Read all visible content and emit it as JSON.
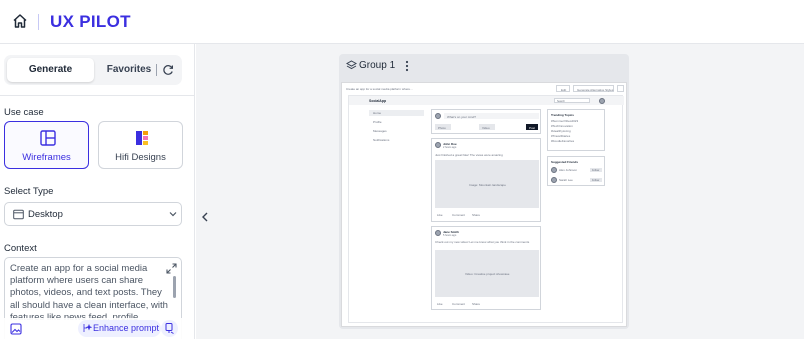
{
  "app": {
    "brand": "UX PILOT"
  },
  "colors": {
    "accent": "#3b2fe0",
    "canvas_bg": "#f3f4f6",
    "accent_soft": "#eef0ff"
  },
  "icons": {
    "home": "home-icon",
    "refresh": "refresh-icon",
    "wireframes": "layout-icon",
    "hifi": "palette-icon",
    "desktop": "monitor-icon",
    "chevron": "chevron-down-icon",
    "expand": "expand-icon",
    "image": "image-icon",
    "enhance": "sparkle-icon",
    "voice": "voice-icon",
    "collapse": "chevron-left-icon",
    "group": "layers-icon",
    "menu": "kebab-icon"
  },
  "tabs": {
    "generate": "Generate",
    "favorites": "Favorites"
  },
  "use_case": {
    "label": "Use case",
    "options": [
      {
        "label": "Wireframes",
        "selected": true
      },
      {
        "label": "Hifi Designs",
        "selected": false
      }
    ]
  },
  "select_type": {
    "label": "Select Type",
    "value": "Desktop"
  },
  "context": {
    "label": "Context",
    "value": "Create an app for a social media platform where users can share photos, videos, and text posts. They all should have a clean interface, with features like news feed, profile"
  },
  "actions": {
    "enhance_prompt": "Enhance prompt"
  },
  "canvas": {
    "group_title": "Group 1",
    "preview": {
      "prompt_line": "Create an app for a social media platform where...",
      "edit_label": "Edit",
      "generate_label": "Generate Alternative Styles",
      "app_title": "SocialApp",
      "search_placeholder": "Search",
      "nav": [
        "Home",
        "Profile",
        "Messages",
        "Notifications"
      ],
      "composer_placeholder": "What's on your mind?",
      "composer_buttons": [
        "Photo",
        "Video"
      ],
      "post_button": "Post",
      "posts": [
        {
          "author": "John Doe",
          "time": "2 hours ago",
          "text": "Just finished a great hike! The views were amazing",
          "image_label": "Image: Mountain landscape",
          "actions": [
            "Like",
            "Comment",
            "Share"
          ]
        },
        {
          "author": "Jane Smith",
          "time": "5 hours ago",
          "text": "Check out my new video! Let me know what you think in the comments",
          "image_label": "Video: Creative project showcase",
          "actions": [
            "Like",
            "Comment",
            "Share"
          ]
        }
      ],
      "trending": {
        "title": "Trending Topics",
        "items": [
          "#SummerVibes2023",
          "#TechInnovation",
          "#HealthyLiving",
          "#TravelDiaries",
          "#FoodieFavorites"
        ]
      },
      "suggested": {
        "title": "Suggested Friends",
        "people": [
          {
            "name": "Alex Johnson",
            "action": "Follow"
          },
          {
            "name": "Sarah Lee",
            "action": "Follow"
          }
        ]
      }
    }
  }
}
